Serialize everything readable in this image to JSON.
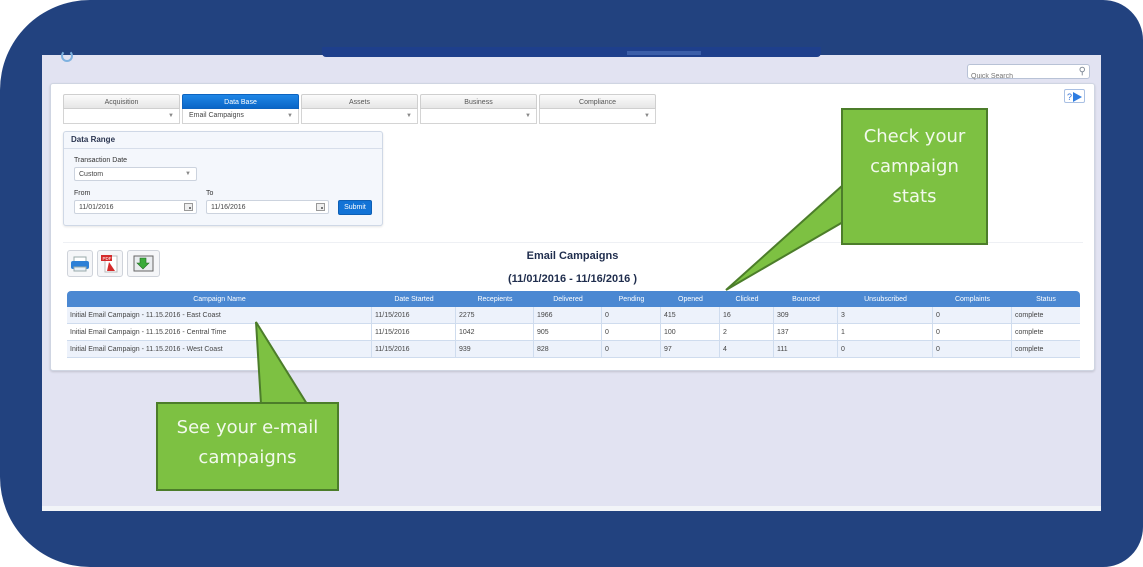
{
  "search": {
    "placeholder": "Quick Search",
    "icon": "magnifier-icon"
  },
  "help": {
    "label": "?",
    "icon": "play-arrow-icon"
  },
  "categories": [
    {
      "tab": "Acquisition",
      "value": "",
      "active": false
    },
    {
      "tab": "Data Base",
      "value": "Email Campaigns",
      "active": true
    },
    {
      "tab": "Assets",
      "value": "",
      "active": false
    },
    {
      "tab": "Business",
      "value": "",
      "active": false
    },
    {
      "tab": "Compliance",
      "value": "",
      "active": false
    }
  ],
  "data_range": {
    "title": "Data Range",
    "transaction_label": "Transaction Date",
    "transaction_value": "Custom",
    "from_label": "From",
    "from_value": "11/01/2016",
    "to_label": "To",
    "to_value": "11/16/2016",
    "submit_label": "Submit"
  },
  "tools": [
    {
      "name": "print",
      "icon": "printer-icon"
    },
    {
      "name": "pdf",
      "icon": "pdf-icon",
      "label": "PDF"
    },
    {
      "name": "export",
      "icon": "export-arrow-icon"
    }
  ],
  "report": {
    "title": "Email Campaigns",
    "subtitle": "(11/01/2016 - 11/16/2016 )",
    "columns": [
      "Campaign Name",
      "Date Started",
      "Recepients",
      "Delivered",
      "Pending",
      "Opened",
      "Clicked",
      "Bounced",
      "Unsubscribed",
      "Complaints",
      "Status"
    ],
    "rows": [
      [
        "Initial Email Campaign - 11.15.2016 - East Coast",
        "11/15/2016",
        "2275",
        "1966",
        "0",
        "415",
        "16",
        "309",
        "3",
        "0",
        "complete"
      ],
      [
        "Initial Email Campaign - 11.15.2016 - Central Time",
        "11/15/2016",
        "1042",
        "905",
        "0",
        "100",
        "2",
        "137",
        "1",
        "0",
        "complete"
      ],
      [
        "Initial Email Campaign - 11.15.2016 - West Coast",
        "11/15/2016",
        "939",
        "828",
        "0",
        "97",
        "4",
        "111",
        "0",
        "0",
        "complete"
      ]
    ]
  },
  "callouts": {
    "stats": "Check your campaign stats",
    "campaigns": "See your e-mail campaigns"
  },
  "colors": {
    "frame": "#22427f",
    "accent_blue": "#1273d6",
    "table_header": "#4b88d2",
    "callout_green": "#7dc142"
  }
}
